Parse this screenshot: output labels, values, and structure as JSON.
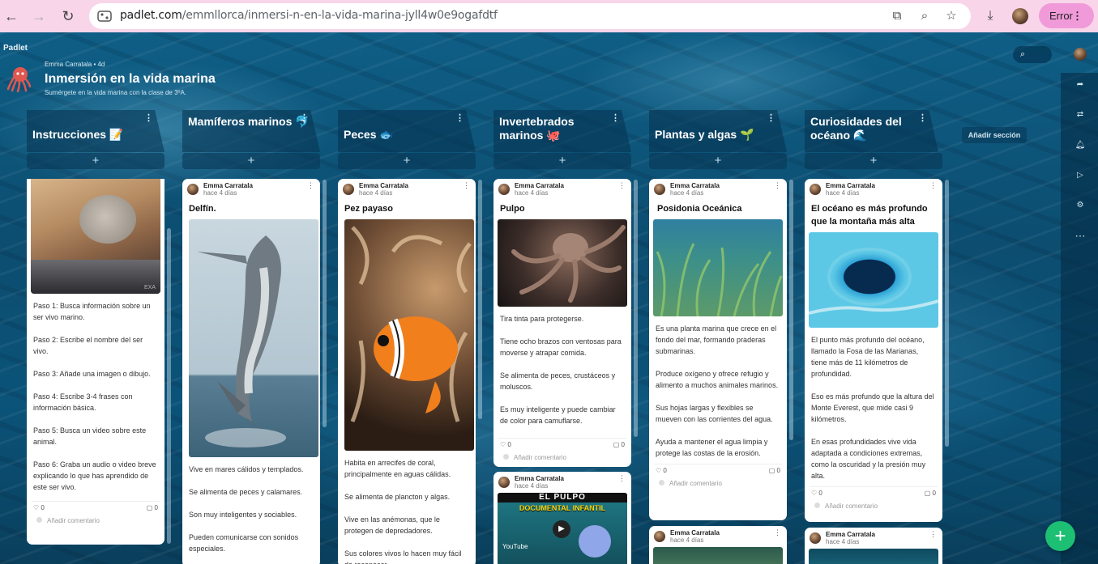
{
  "browser": {
    "url_host": "padlet.com",
    "url_path": "/emmllorca/inmersi-n-en-la-vida-marina-jyll4w0e9ogafdtf",
    "error_label": "Error"
  },
  "board": {
    "logo": "Padlet",
    "author_line": "Emma Carratala • 4d",
    "title": "Inmersión en la vida marina",
    "subtitle": "Sumérgete en la vida marina con la clase de 3ºA.",
    "add_section": "Añadir sección"
  },
  "columns": [
    {
      "title": "Instrucciones 📝"
    },
    {
      "title": "Mamíferos marinos 🐬"
    },
    {
      "title": "Peces 🐟"
    },
    {
      "title": "Invertebrados marinos 🐙"
    },
    {
      "title": "Plantas y algas 🌱"
    },
    {
      "title": "Curiosidades del océano 🌊"
    }
  ],
  "cards": {
    "instr": {
      "body": "Paso 1: Busca información sobre un ser vivo marino.\n\nPaso 2: Escribe el nombre del ser vivo.\n\nPaso 3: Añade una imagen o dibujo.\n\nPaso 4: Escribe 3-4 frases con información básica.\n\nPaso 5: Busca un video sobre este animal.\n\nPaso 6: Graba un audio o video breve explicando lo que has aprendido de este ser vivo.",
      "likes": "0",
      "comments": "0",
      "add_comment": "Añadir comentario",
      "image_watermark": "EXA"
    },
    "delfin": {
      "author": "Emma Carratala",
      "time": "hace 4 días",
      "title": "Delfín.",
      "body": "Vive en mares cálidos y templados.\n\nSe alimenta de peces y calamares.\n\nSon muy inteligentes y sociables.\n\nPueden comunicarse con sonidos especiales."
    },
    "payaso": {
      "author": "Emma Carratala",
      "time": "hace 4 días",
      "title": "Pez payaso",
      "body": "Habita en arrecifes de coral, principalmente en aguas cálidas.\n\nSe alimenta de plancton y algas.\n\nVive en las anémonas, que le protegen de depredadores.\n\nSus colores vivos lo hacen muy fácil de reconocer."
    },
    "pulpo": {
      "author": "Emma Carratala",
      "time": "hace 4 días",
      "title": "Pulpo",
      "body": "Tira tinta para protegerse.\n\nTiene ocho brazos con ventosas para moverse y atrapar comida.\n\nSe alimenta de peces, crustáceos y moluscos.\n\nEs muy inteligente y puede cambiar de color para camuflarse.",
      "likes": "0",
      "comments": "0",
      "add_comment": "Añadir comentario"
    },
    "pulpo2": {
      "author": "Emma Carratala",
      "time": "hace 4 días",
      "thumb_title": "EL PULPO",
      "thumb_sub": "DOCUMENTAL INFANTIL",
      "thumb_src": "YouTube"
    },
    "posidonia": {
      "author": "Emma Carratala",
      "time": "hace 4 días",
      "title": "Posidonia Oceánica",
      "body": "Es una planta marina que crece en el fondo del mar, formando praderas submarinas.\n\nProduce oxígeno y ofrece refugio y alimento a muchos animales marinos.\n\nSus hojas largas y flexibles se mueven con las corrientes del agua.\n\nAyuda a mantener el agua limpia y protege las costas de la erosión.",
      "likes": "0",
      "comments": "0",
      "add_comment": "Añadir comentario"
    },
    "plantas2": {
      "author": "Emma Carratala",
      "time": "hace 4 días"
    },
    "oceano": {
      "author": "Emma Carratala",
      "time": "hace 4 días",
      "title": "El océano es más profundo que la montaña más alta",
      "body": "El punto más profundo del océano, llamado la Fosa de las Marianas, tiene más de 11 kilómetros de profundidad.\n\nEso es más profundo que la altura del Monte Everest, que mide casi 9 kilómetros.\n\nEn esas profundidades vive vida adaptada a condiciones extremas, como la oscuridad y la presión muy alta.",
      "likes": "0",
      "comments": "0",
      "add_comment": "Añadir comentario"
    },
    "oceano2": {
      "author": "Emma Carratala",
      "time": "hace 4 días"
    }
  },
  "colors": {
    "chrome": "#f9d5ea",
    "accent_error": "#f19ad9",
    "fab": "#1dbf73",
    "sea": "#0c4d70"
  }
}
